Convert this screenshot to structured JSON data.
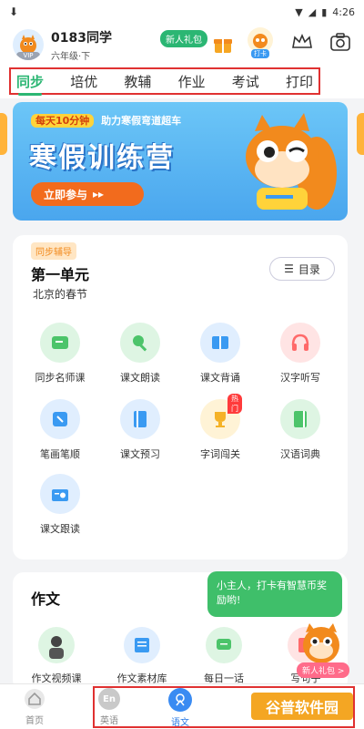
{
  "status": {
    "time": "4:26"
  },
  "user": {
    "name": "0183同学",
    "grade": "六年级·下",
    "vip": "VIP"
  },
  "header": {
    "newbie_gift": "新人礼包",
    "checkin": "打卡"
  },
  "tabs": [
    {
      "label": "同步",
      "active": true
    },
    {
      "label": "培优",
      "active": false
    },
    {
      "label": "教辅",
      "active": false
    },
    {
      "label": "作业",
      "active": false
    },
    {
      "label": "考试",
      "active": false
    },
    {
      "label": "打印",
      "active": false
    }
  ],
  "banner": {
    "pill": "每天10分钟",
    "subtitle": "助力寒假弯道超车",
    "title": "寒假训练营",
    "cta": "立即参与"
  },
  "unit": {
    "badge": "同步辅导",
    "title": "第一单元",
    "subtitle": "北京的春节",
    "toc": "目录"
  },
  "features": [
    {
      "label": "同步名师课",
      "icon": "video-icon",
      "color": "#4cc46a"
    },
    {
      "label": "课文朗读",
      "icon": "mic-icon",
      "color": "#4cc46a"
    },
    {
      "label": "课文背诵",
      "icon": "book-icon",
      "color": "#3a9af2"
    },
    {
      "label": "汉字听写",
      "icon": "headphone-icon",
      "color": "#ff6a6a"
    },
    {
      "label": "笔画笔顺",
      "icon": "pen-icon",
      "color": "#3a9af2"
    },
    {
      "label": "课文预习",
      "icon": "notebook-icon",
      "color": "#3a9af2"
    },
    {
      "label": "字词闯关",
      "icon": "trophy-icon",
      "color": "#f5b227",
      "hot": "热门"
    },
    {
      "label": "汉语词典",
      "icon": "dictionary-icon",
      "color": "#4cc46a"
    },
    {
      "label": "课文跟读",
      "icon": "radio-icon",
      "color": "#3a9af2"
    }
  ],
  "essay": {
    "title": "作文",
    "items": [
      {
        "label": "作文视频课"
      },
      {
        "label": "作文素材库"
      },
      {
        "label": "每日一话"
      },
      {
        "label": "写句子"
      }
    ]
  },
  "bubble": {
    "text": "小主人，打卡有智慧币奖励哟!",
    "gift": "新人礼包 >"
  },
  "bottom_nav": [
    {
      "label": "首页",
      "icon": "home-icon",
      "active": false
    },
    {
      "label": "英语",
      "icon": "english-icon",
      "active": false
    },
    {
      "label": "语文",
      "icon": "chinese-icon",
      "active": true
    }
  ],
  "watermark": "谷普软件园"
}
